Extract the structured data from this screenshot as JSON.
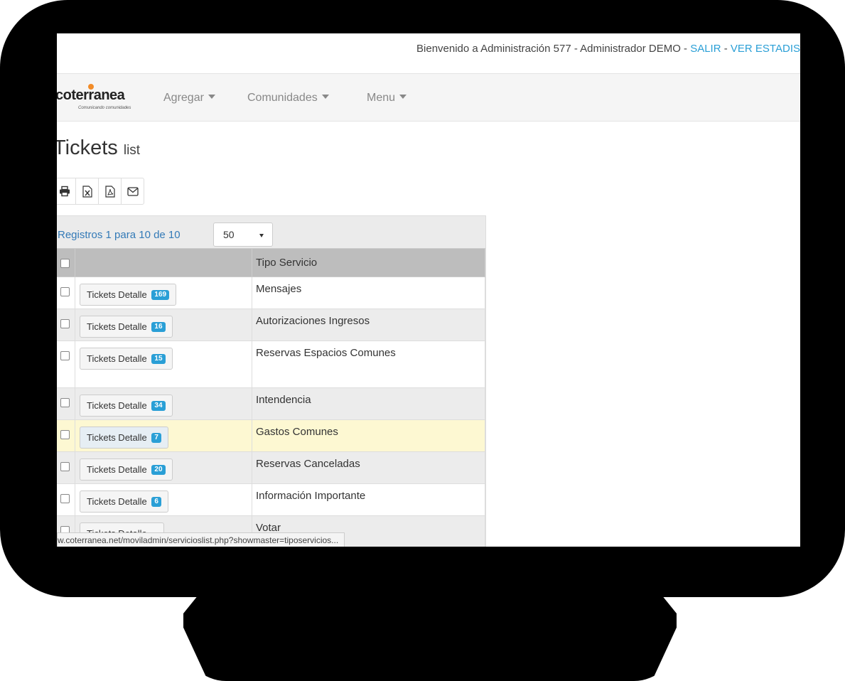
{
  "header": {
    "welcome_text": "Bienvenido a Administración 577 - Administrador DEMO - ",
    "salir": "SALIR",
    "sep": " - ",
    "ver_estadisticas": "VER ESTADIS"
  },
  "navbar": {
    "logo_text": "coterranea",
    "logo_tagline": "Comunicando comunidades",
    "items": [
      {
        "label": "Agregar"
      },
      {
        "label": "Comunidades"
      },
      {
        "label": "Menu"
      }
    ]
  },
  "page": {
    "title": "Tickets",
    "subtitle": "list"
  },
  "toolbar": {
    "icons": [
      "print-icon",
      "excel-icon",
      "pdf-icon",
      "email-icon"
    ]
  },
  "grid": {
    "records_text": "Registros 1 para 10 de 10",
    "page_size": "50",
    "header": {
      "tipo": "Tipo Servicio"
    },
    "button_label": "Tickets Detalle",
    "rows": [
      {
        "count": "169",
        "tipo": "Mensajes"
      },
      {
        "count": "16",
        "tipo": "Autorizaciones Ingresos"
      },
      {
        "count": "15",
        "tipo": "Reservas Espacios Comunes"
      },
      {
        "count": "34",
        "tipo": "Intendencia"
      },
      {
        "count": "7",
        "tipo": "Gastos Comunes"
      },
      {
        "count": "20",
        "tipo": "Reservas Canceladas"
      },
      {
        "count": "6",
        "tipo": "Información Importante"
      },
      {
        "count": "",
        "tipo": "Votar"
      }
    ]
  },
  "statusbar": {
    "url": "w.coterranea.net/moviladmin/servicioslist.php?showmaster=tiposervicios..."
  },
  "colors": {
    "link": "#2a9fd6",
    "badge": "#2a9fd6",
    "highlight_row": "#fdf8d2"
  }
}
